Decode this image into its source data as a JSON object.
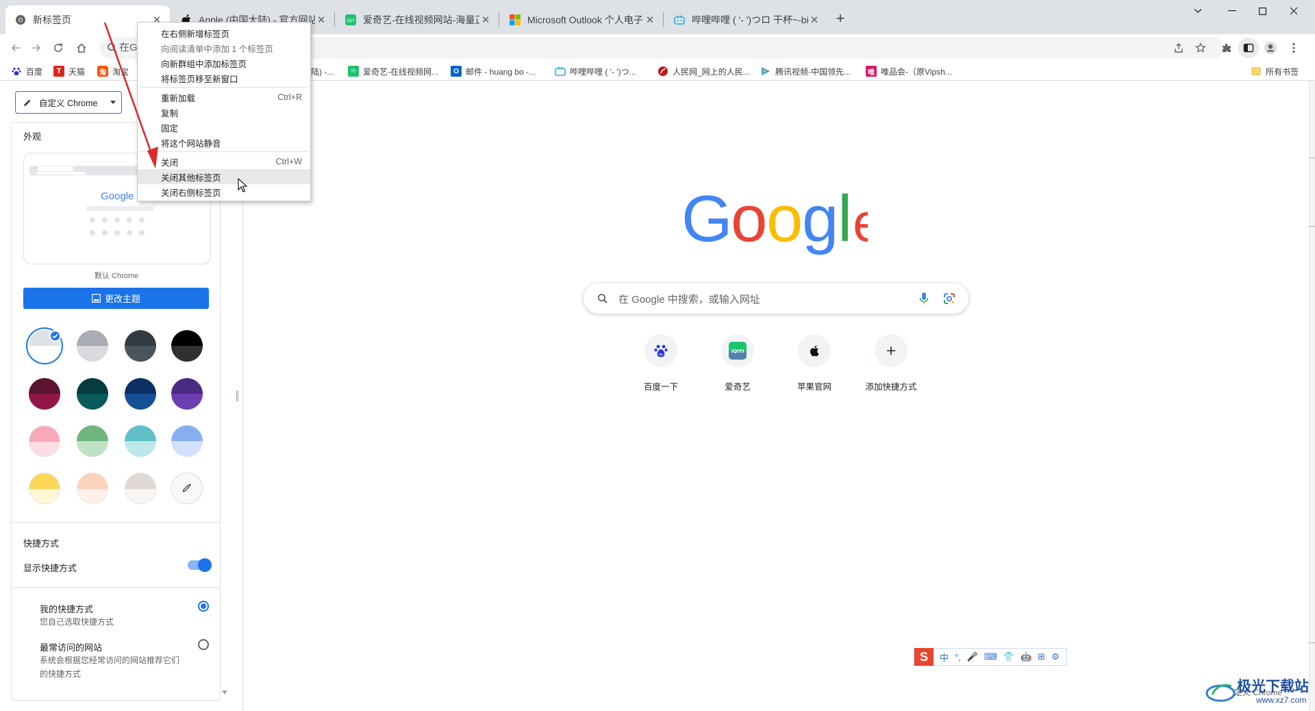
{
  "tabs": [
    {
      "title": "新标签页",
      "active": true
    },
    {
      "title": "Apple (中国大陆) - 官方网站",
      "active": false
    },
    {
      "title": "爱奇艺-在线视频网站-海量正版高清视频",
      "active": false
    },
    {
      "title": "Microsoft Outlook 个人电子邮件和日历",
      "active": false
    },
    {
      "title": "哔哩哔哩 ( '- ')つロ 干杯~-bilibili",
      "active": false
    }
  ],
  "omnibox": {
    "placeholder_fragment": "在G"
  },
  "bookmarks": [
    {
      "label": "百度",
      "icon": "paw-icon"
    },
    {
      "label": "天猫",
      "icon": "tmall-icon"
    },
    {
      "label": "淘宝",
      "icon": "taobao-icon"
    },
    {
      "label": "陆) -...",
      "icon": ""
    },
    {
      "label": "爱奇艺-在线视频网...",
      "icon": "iqiyi-icon"
    },
    {
      "label": "邮件 - huang bo -...",
      "icon": "outlook-icon"
    },
    {
      "label": "哔哩哔哩 ( '- ')つ...",
      "icon": "bilibili-icon"
    },
    {
      "label": "人民网_网上的人民...",
      "icon": "people-icon"
    },
    {
      "label": "腾讯视频-中国领先...",
      "icon": "tencent-video-icon"
    },
    {
      "label": "唯品会-（原Vipsh...",
      "icon": "vip-icon"
    },
    {
      "label": "所有书签",
      "icon": "folder-icon"
    }
  ],
  "context_menu": [
    {
      "label": "在右侧新增标签页",
      "shortcut": "",
      "state": "normal"
    },
    {
      "label": "向阅读清单中添加 1 个标签页",
      "shortcut": "",
      "state": "disabled"
    },
    {
      "label": "向新群组中添加标签页",
      "shortcut": "",
      "state": "normal"
    },
    {
      "label": "将标签页移至新窗口",
      "shortcut": "",
      "state": "normal"
    },
    {
      "label": "重新加载",
      "shortcut": "Ctrl+R",
      "state": "normal"
    },
    {
      "label": "复制",
      "shortcut": "",
      "state": "normal"
    },
    {
      "label": "固定",
      "shortcut": "",
      "state": "normal"
    },
    {
      "label": "将这个网站静音",
      "shortcut": "",
      "state": "normal"
    },
    {
      "label": "关闭",
      "shortcut": "Ctrl+W",
      "state": "normal"
    },
    {
      "label": "关闭其他标签页",
      "shortcut": "",
      "state": "hover"
    },
    {
      "label": "关闭右侧标签页",
      "shortcut": "",
      "state": "normal"
    }
  ],
  "side_panel": {
    "selector_label": "自定义 Chrome",
    "appearance_title": "外观",
    "preview_caption": "默认 Chrome",
    "preview_logo": "Google",
    "change_theme_label": "更改主题",
    "swatches": [
      {
        "top": "#dfe3e8",
        "bottom": "#ffffff",
        "selected": true
      },
      {
        "top": "#a9acb5",
        "bottom": "#d9dade",
        "selected": false
      },
      {
        "top": "#353b42",
        "bottom": "#4d555c",
        "selected": false
      },
      {
        "top": "#000000",
        "bottom": "#303030",
        "selected": false
      },
      {
        "top": "#5a1430",
        "bottom": "#8f1647",
        "selected": false
      },
      {
        "top": "#063c3e",
        "bottom": "#0a5a5c",
        "selected": false
      },
      {
        "top": "#0c2f64",
        "bottom": "#164f94",
        "selected": false
      },
      {
        "top": "#4a2a82",
        "bottom": "#6e3fb2",
        "selected": false
      },
      {
        "top": "#f8a8b8",
        "bottom": "#fcdde3",
        "selected": false
      },
      {
        "top": "#6fb67d",
        "bottom": "#bfe2c3",
        "selected": false
      },
      {
        "top": "#5fc0c8",
        "bottom": "#bde7ea",
        "selected": false
      },
      {
        "top": "#87aef0",
        "bottom": "#d2e0fb",
        "selected": false
      },
      {
        "top": "#fbd75a",
        "bottom": "#fff7d6",
        "selected": false
      },
      {
        "top": "#fbd3bd",
        "bottom": "#fff1e9",
        "selected": false
      },
      {
        "top": "#e0d8d4",
        "bottom": "#f8f5f3",
        "selected": false
      }
    ],
    "shortcuts_title": "快捷方式",
    "show_shortcuts_label": "显示快捷方式",
    "show_shortcuts_on": true,
    "option_mine_title": "我的快捷方式",
    "option_mine_desc": "您自己选取快捷方式",
    "option_mine_selected": true,
    "option_frequent_title": "最常访问的网站",
    "option_frequent_desc_1": "系统会根据您经常访问的网站推荐它们",
    "option_frequent_desc_2": "的快捷方式",
    "option_frequent_selected": false
  },
  "ntp": {
    "logo": "Google",
    "search_placeholder": "在 Google 中搜索，或输入网址",
    "shortcuts": [
      {
        "label": "百度一下",
        "icon": "baidu-icon"
      },
      {
        "label": "爱奇艺",
        "icon": "iqiyi-icon"
      },
      {
        "label": "苹果官网",
        "icon": "apple-icon"
      },
      {
        "label": "添加快捷方式",
        "icon": "plus-icon"
      }
    ]
  },
  "ime_toolbar": {
    "logo": "S",
    "items": [
      "中",
      "°,",
      "🎤",
      "⌨",
      "👕",
      "🤖",
      "⊞",
      "⚙"
    ]
  },
  "watermark": {
    "name": "极光下载站",
    "url": "www.xz7.com",
    "overlay": "定义 Chrome"
  },
  "colors": {
    "accent": "#1a73e8",
    "tabstrip": "#dee1e6",
    "google_blue": "#4285f4",
    "google_red": "#ea4335",
    "google_yellow": "#fbbc05",
    "google_green": "#34a853",
    "annotation_arrow": "#d92b2b"
  }
}
